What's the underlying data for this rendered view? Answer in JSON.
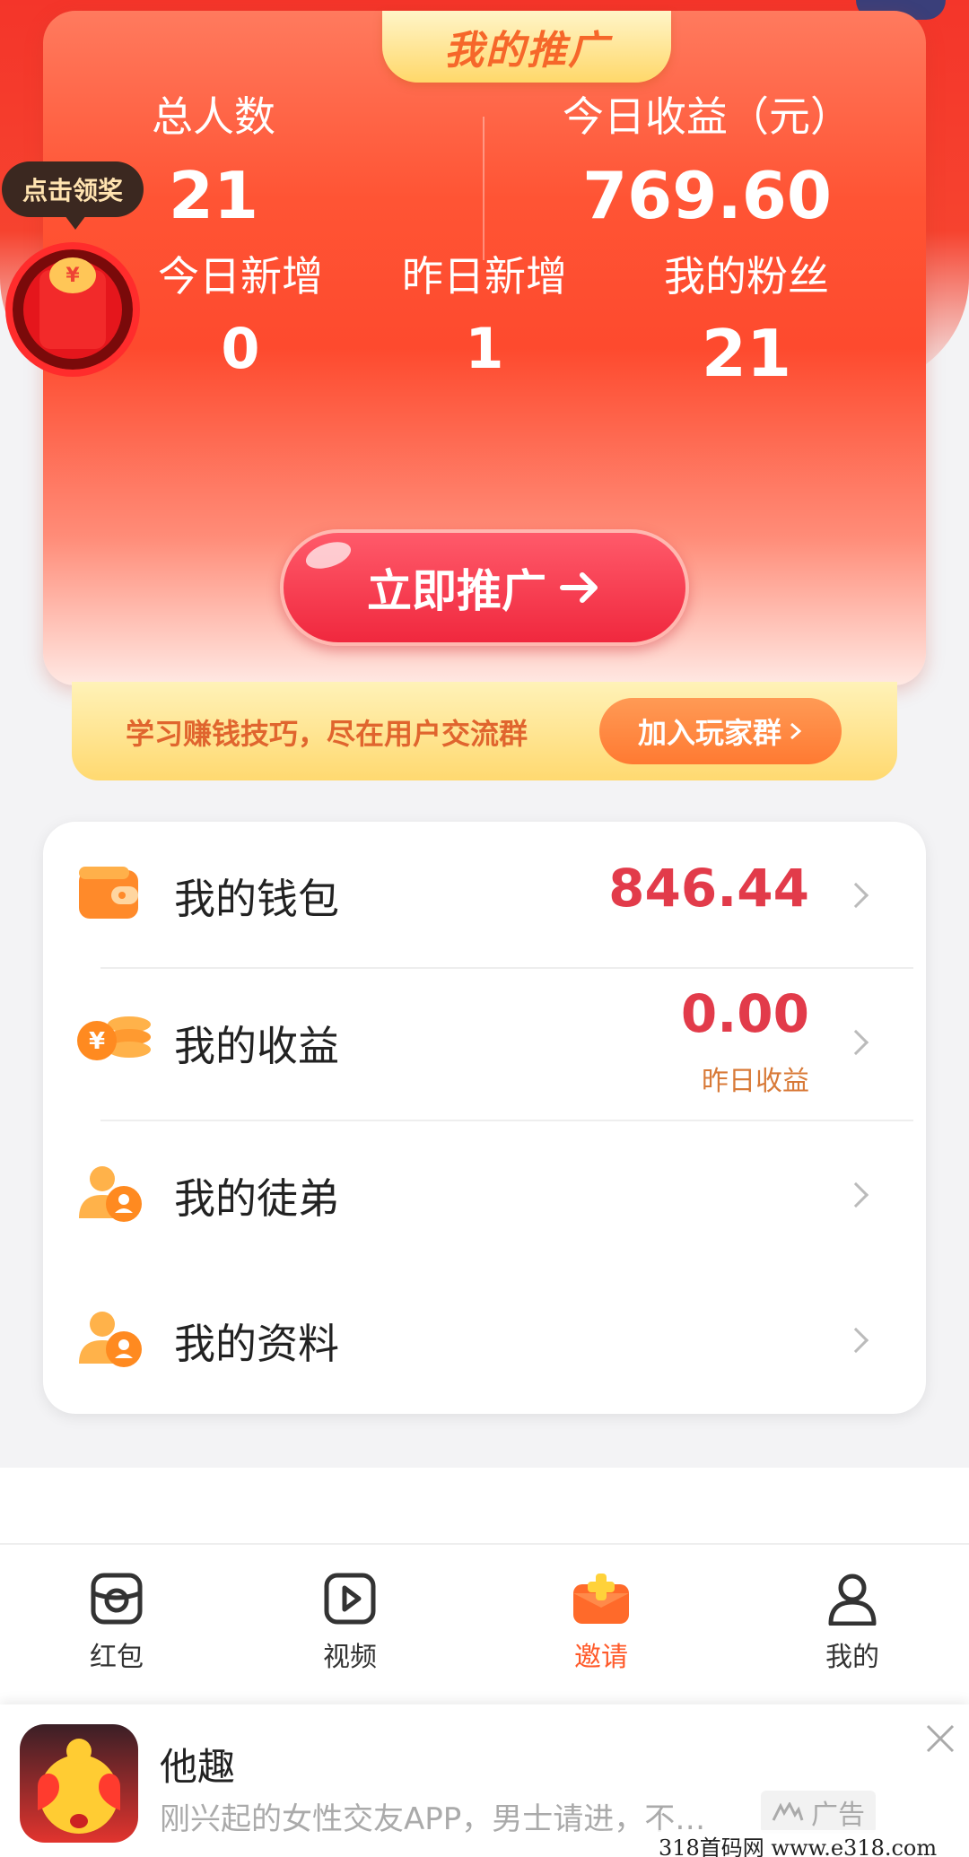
{
  "header": {
    "title": "我的推广"
  },
  "stats": {
    "total_people_label": "总人数",
    "total_people_value": "21",
    "today_income_label": "今日收益（元）",
    "today_income_value": "769.60",
    "today_new_label": "今日新增",
    "today_new_value": "0",
    "yesterday_new_label": "昨日新增",
    "yesterday_new_value": "1",
    "fans_label": "我的粉丝",
    "fans_value": "21"
  },
  "promo_button_label": "立即推广",
  "group_banner": {
    "text": "学习赚钱技巧，尽在用户交流群",
    "button_label": "加入玩家群"
  },
  "reward": {
    "tip": "点击领奖"
  },
  "menu": {
    "wallet": {
      "label": "我的钱包",
      "value": "846.44"
    },
    "income": {
      "label": "我的收益",
      "value": "0.00",
      "sub": "昨日收益"
    },
    "apprentice": {
      "label": "我的徒弟"
    },
    "profile": {
      "label": "我的资料"
    }
  },
  "bottom_nav": {
    "items": [
      {
        "label": "红包",
        "icon": "red-packet-icon",
        "active": false
      },
      {
        "label": "视频",
        "icon": "video-icon",
        "active": false
      },
      {
        "label": "邀请",
        "icon": "invite-icon",
        "active": true
      },
      {
        "label": "我的",
        "icon": "profile-icon",
        "active": false
      }
    ]
  },
  "ad": {
    "title": "他趣",
    "description": "刚兴起的女性交友APP，男士请进，不…",
    "badge": "广告"
  },
  "watermark": "318首码网  www.e318.com",
  "colors": {
    "accent": "#ff5a2a",
    "value_red": "#e23b4a",
    "card_red": "#fe4a2e"
  }
}
